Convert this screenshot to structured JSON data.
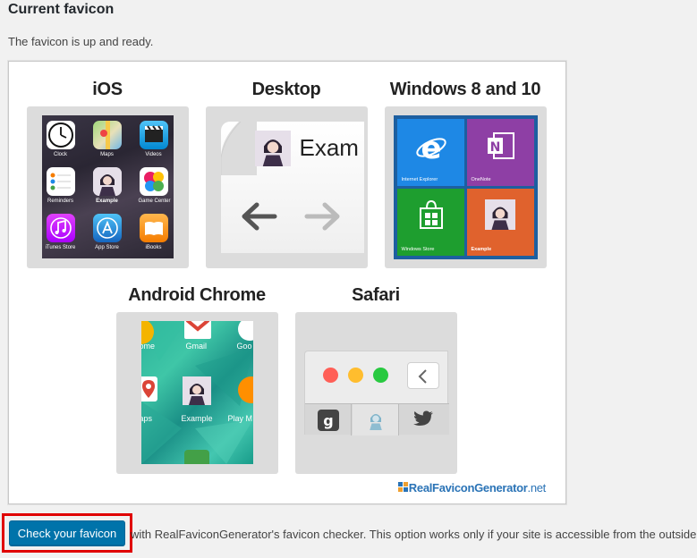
{
  "section": {
    "title": "Current favicon",
    "subtitle": "The favicon is up and ready."
  },
  "platforms": {
    "ios": {
      "title": "iOS",
      "apps": [
        "Clock",
        "Maps",
        "Videos",
        "Reminders",
        "Example",
        "Game Center",
        "iTunes Store",
        "App Store",
        "iBooks"
      ]
    },
    "desktop": {
      "title": "Desktop",
      "tab_text": "Exam"
    },
    "windows": {
      "title": "Windows 8 and 10",
      "tiles": [
        "Internet Explorer",
        "OneNote",
        "Windows Store",
        "Example"
      ]
    },
    "android": {
      "title": "Android Chrome",
      "labels": [
        "ome",
        "Gmail",
        "Goo",
        "aps",
        "Example",
        "Play M"
      ]
    },
    "safari": {
      "title": "Safari"
    }
  },
  "branding": {
    "logo_bold": "RealFaviconGenerator",
    "logo_thin": ".net"
  },
  "check": {
    "button_label": "Check your favicon",
    "description": "with RealFaviconGenerator's favicon checker. This option works only if your site is accessible from the outside."
  },
  "colors": {
    "accent_button": "#0073aa",
    "highlight_border": "#e00000",
    "windows_ie_tile": "#1e88e5",
    "windows_onenote_tile": "#8e3fa5",
    "windows_store_tile": "#1e9e2f",
    "windows_example_tile": "#e0622d"
  }
}
